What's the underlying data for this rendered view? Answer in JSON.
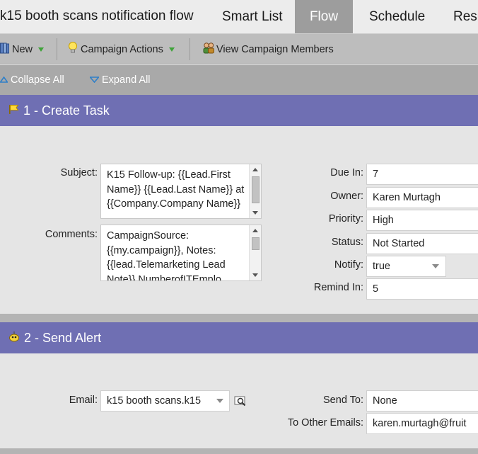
{
  "header": {
    "campaign_title": "k15 booth scans notification flow",
    "tabs": [
      {
        "label": "Smart List"
      },
      {
        "label": "Flow"
      },
      {
        "label": "Schedule"
      },
      {
        "label": "Resu"
      }
    ]
  },
  "toolbar": {
    "new_label": "New",
    "campaign_actions_label": "Campaign Actions",
    "view_members_label": "View Campaign Members"
  },
  "collapse_bar": {
    "collapse_label": "Collapse All",
    "expand_label": "Expand All"
  },
  "step1": {
    "title": "1 - Create Task",
    "subject_label": "Subject:",
    "subject_value": "K15 Follow-up: {{Lead.First Name}} {{Lead.Last Name}} at {{Company.Company Name}}",
    "comments_label": "Comments:",
    "comments_value": "CampaignSource: {{my.campaign}}, Notes: {{lead.Telemarketing Lead Note}} NumberofITEmplo",
    "due_in_label": "Due In:",
    "due_in_value": "7",
    "owner_label": "Owner:",
    "owner_value": "Karen Murtagh",
    "priority_label": "Priority:",
    "priority_value": "High",
    "status_label": "Status:",
    "status_value": "Not Started",
    "notify_label": "Notify:",
    "notify_value": "true",
    "remind_in_label": "Remind In:",
    "remind_in_value": "5"
  },
  "step2": {
    "title": "2 - Send Alert",
    "email_label": "Email:",
    "email_value": "k15 booth scans.k15",
    "send_to_label": "Send To:",
    "send_to_value": "None",
    "other_emails_label": "To Other Emails:",
    "other_emails_value": "karen.murtagh@fruit"
  },
  "colors": {
    "step_header": "#6f6fb3",
    "active_tab": "#9d9d9d",
    "toolbar": "#bdbdbd",
    "collapse_bar": "#a9a9a9",
    "dropdown_accent": "#3fa33a"
  }
}
